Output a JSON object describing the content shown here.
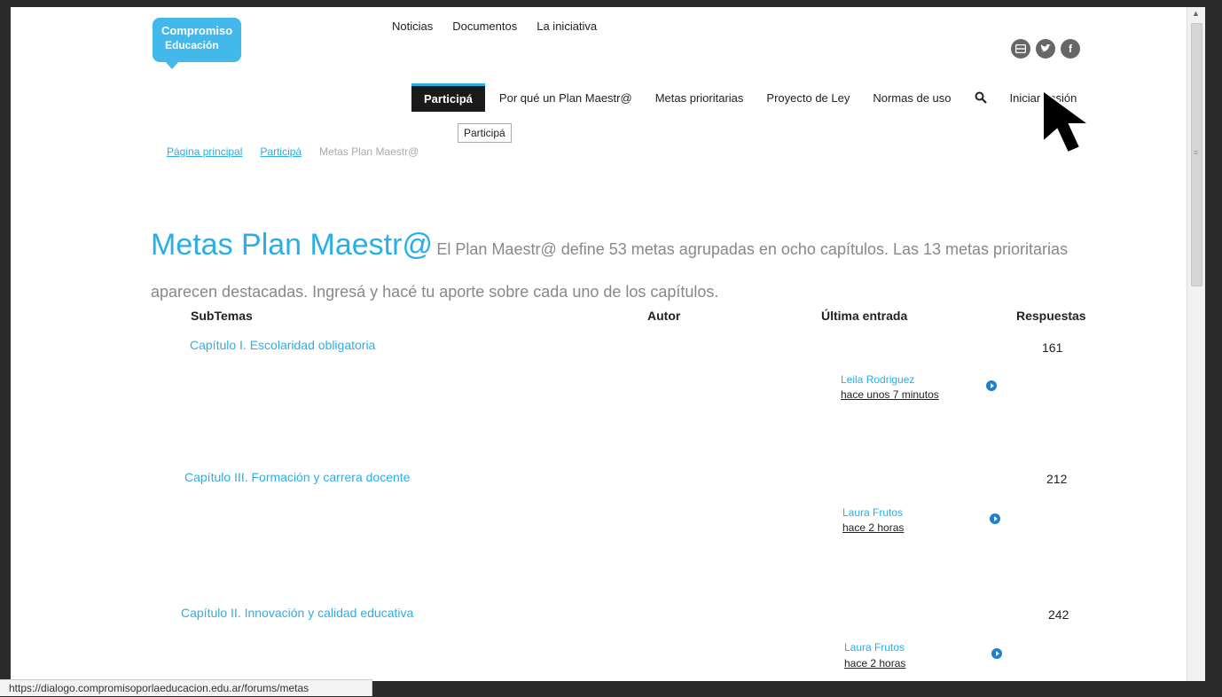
{
  "logo": {
    "line1": "Compromiso",
    "line2": "Educación"
  },
  "top_nav": [
    "Noticias",
    "Documentos",
    "La iniciativa"
  ],
  "social_icons": [
    "email-icon",
    "twitter-icon",
    "facebook-icon"
  ],
  "main_nav": {
    "active": "Participá",
    "items": [
      "Por qué un Plan Maestr@",
      "Metas prioritarias",
      "Proyecto de Ley",
      "Normas de uso"
    ],
    "login": "Iniciar sesión"
  },
  "tooltip": "Participá",
  "breadcrumb": {
    "home": "Página principal",
    "section": "Participá",
    "current": "Metas Plan Maestr@"
  },
  "page": {
    "title": "Metas Plan Maestr@",
    "description": "El Plan Maestr@ define 53 metas agrupadas en ocho capítulos. Las 13 metas prioritarias aparecen destacadas. Ingresá y hacé tu aporte sobre cada uno de los capítulos."
  },
  "table": {
    "headers": {
      "subtopics": "SubTemas",
      "author": "Autor",
      "last_entry": "Última entrada",
      "replies": "Respuestas"
    },
    "rows": [
      {
        "title": "Capítulo I. Escolaridad obligatoria",
        "replies": "161",
        "last_author": "Leila Rodriguez",
        "last_time": "hace unos 7 minutos"
      },
      {
        "title": "Capítulo III. Formación y carrera docente",
        "replies": "212",
        "last_author": "Laura Frutos",
        "last_time": "hace 2 horas"
      },
      {
        "title": "Capítulo II. Innovación y calidad educativa",
        "replies": "242",
        "last_author": "Laura Frutos",
        "last_time": "hace 2 horas"
      }
    ]
  },
  "status_bar": "https://dialogo.compromisoporlaeducacion.edu.ar/forums/metas",
  "colors": {
    "accent": "#29aee6",
    "nav_active_bg": "#1a1a1a",
    "go_icon": "#1f7ed0"
  }
}
